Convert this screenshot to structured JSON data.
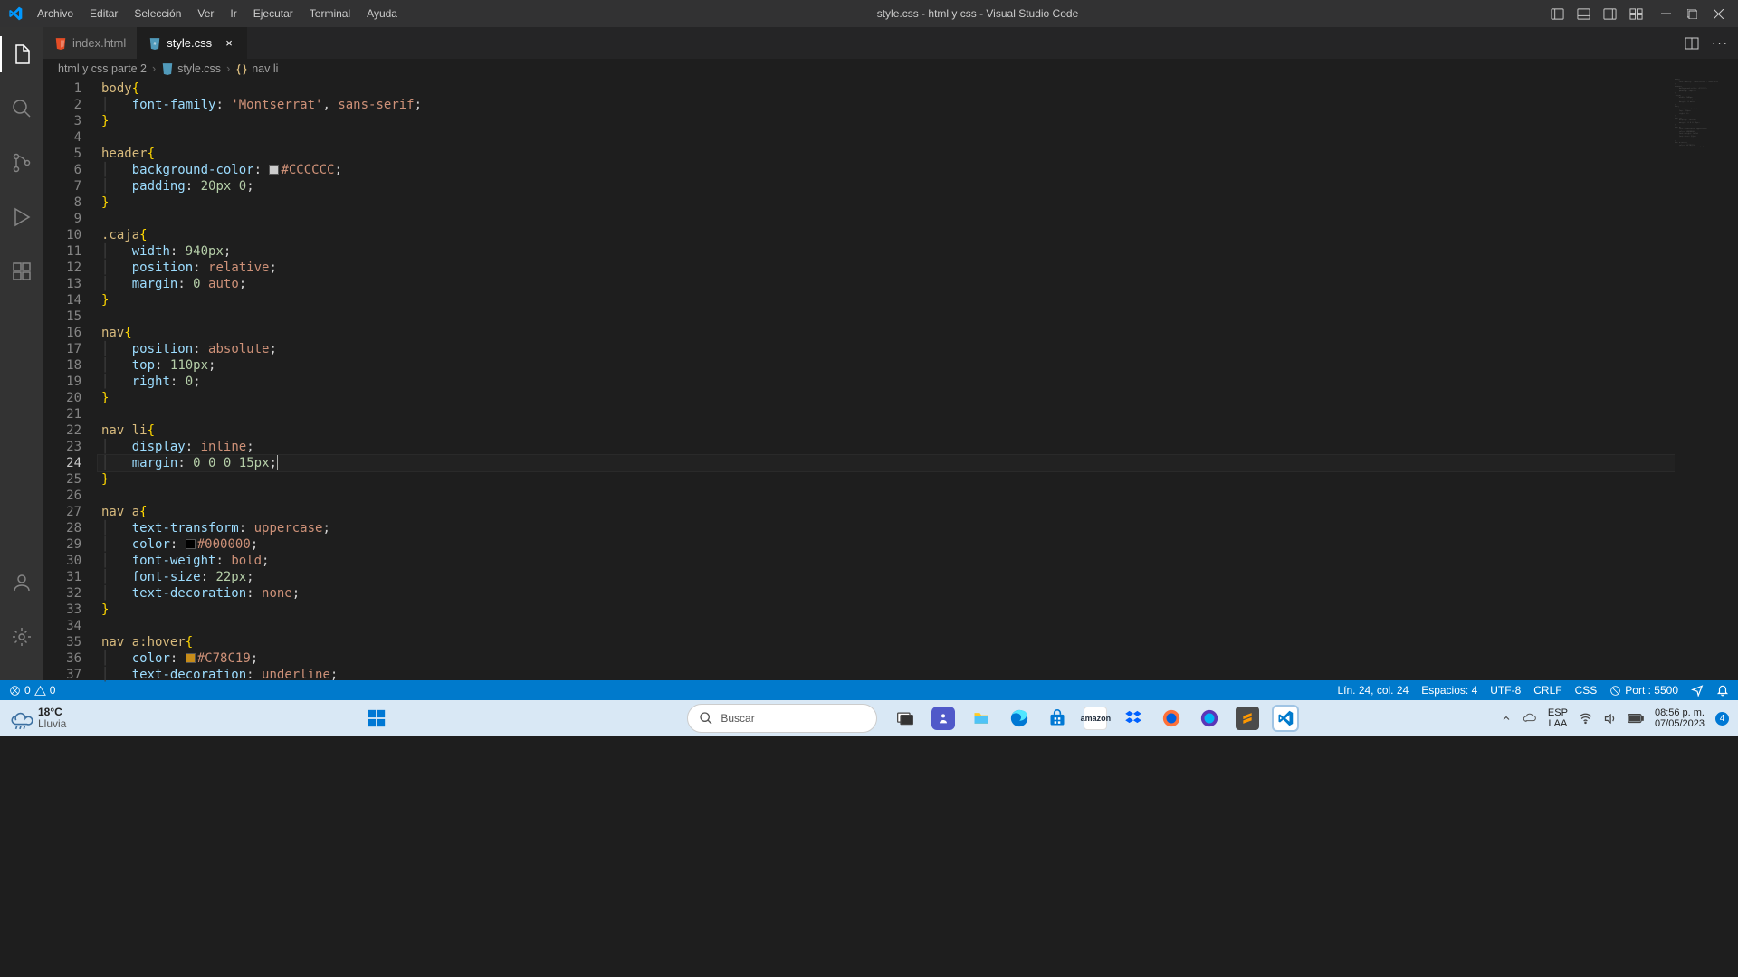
{
  "titlebar": {
    "menus": [
      "Archivo",
      "Editar",
      "Selección",
      "Ver",
      "Ir",
      "Ejecutar",
      "Terminal",
      "Ayuda"
    ],
    "title": "style.css - html y css - Visual Studio Code"
  },
  "tabs": [
    {
      "name": "index.html",
      "icon": "html",
      "icon_color": "#e44d26",
      "active": false
    },
    {
      "name": "style.css",
      "icon": "css",
      "icon_color": "#519aba",
      "active": true,
      "close": true
    }
  ],
  "breadcrumbs": {
    "parts": [
      "html y css parte 2",
      "style.css",
      "nav li"
    ]
  },
  "code": {
    "current_line": 24,
    "lines": [
      [
        {
          "t": "body",
          "c": "sel"
        },
        {
          "t": "{",
          "c": "brace"
        }
      ],
      [
        {
          "t": "    ",
          "c": ""
        },
        {
          "t": "font-family",
          "c": "prop"
        },
        {
          "t": ": ",
          "c": "punct"
        },
        {
          "t": "'Montserrat'",
          "c": "val"
        },
        {
          "t": ", ",
          "c": "punct"
        },
        {
          "t": "sans-serif",
          "c": "kw"
        },
        {
          "t": ";",
          "c": "punct"
        }
      ],
      [
        {
          "t": "}",
          "c": "brace"
        }
      ],
      [],
      [
        {
          "t": "header",
          "c": "sel"
        },
        {
          "t": "{",
          "c": "brace"
        }
      ],
      [
        {
          "t": "    ",
          "c": ""
        },
        {
          "t": "background-color",
          "c": "prop"
        },
        {
          "t": ": ",
          "c": "punct"
        },
        {
          "t": "□",
          "c": "colorswatch",
          "bg": "#CCCCCC"
        },
        {
          "t": "#CCCCCC",
          "c": "kw"
        },
        {
          "t": ";",
          "c": "punct"
        }
      ],
      [
        {
          "t": "    ",
          "c": ""
        },
        {
          "t": "padding",
          "c": "prop"
        },
        {
          "t": ": ",
          "c": "punct"
        },
        {
          "t": "20px",
          "c": "num"
        },
        {
          "t": " ",
          "c": ""
        },
        {
          "t": "0",
          "c": "num"
        },
        {
          "t": ";",
          "c": "punct"
        }
      ],
      [
        {
          "t": "}",
          "c": "brace"
        }
      ],
      [],
      [
        {
          "t": ".caja",
          "c": "sel"
        },
        {
          "t": "{",
          "c": "brace"
        }
      ],
      [
        {
          "t": "    ",
          "c": ""
        },
        {
          "t": "width",
          "c": "prop"
        },
        {
          "t": ": ",
          "c": "punct"
        },
        {
          "t": "940px",
          "c": "num"
        },
        {
          "t": ";",
          "c": "punct"
        }
      ],
      [
        {
          "t": "    ",
          "c": ""
        },
        {
          "t": "position",
          "c": "prop"
        },
        {
          "t": ": ",
          "c": "punct"
        },
        {
          "t": "relative",
          "c": "kw"
        },
        {
          "t": ";",
          "c": "punct"
        }
      ],
      [
        {
          "t": "    ",
          "c": ""
        },
        {
          "t": "margin",
          "c": "prop"
        },
        {
          "t": ": ",
          "c": "punct"
        },
        {
          "t": "0",
          "c": "num"
        },
        {
          "t": " ",
          "c": ""
        },
        {
          "t": "auto",
          "c": "kw"
        },
        {
          "t": ";",
          "c": "punct"
        }
      ],
      [
        {
          "t": "}",
          "c": "brace"
        }
      ],
      [],
      [
        {
          "t": "nav",
          "c": "sel"
        },
        {
          "t": "{",
          "c": "brace"
        }
      ],
      [
        {
          "t": "    ",
          "c": ""
        },
        {
          "t": "position",
          "c": "prop"
        },
        {
          "t": ": ",
          "c": "punct"
        },
        {
          "t": "absolute",
          "c": "kw"
        },
        {
          "t": ";",
          "c": "punct"
        }
      ],
      [
        {
          "t": "    ",
          "c": ""
        },
        {
          "t": "top",
          "c": "prop"
        },
        {
          "t": ": ",
          "c": "punct"
        },
        {
          "t": "110px",
          "c": "num"
        },
        {
          "t": ";",
          "c": "punct"
        }
      ],
      [
        {
          "t": "    ",
          "c": ""
        },
        {
          "t": "right",
          "c": "prop"
        },
        {
          "t": ": ",
          "c": "punct"
        },
        {
          "t": "0",
          "c": "num"
        },
        {
          "t": ";",
          "c": "punct"
        }
      ],
      [
        {
          "t": "}",
          "c": "brace"
        }
      ],
      [],
      [
        {
          "t": "nav li",
          "c": "sel"
        },
        {
          "t": "{",
          "c": "brace"
        }
      ],
      [
        {
          "t": "    ",
          "c": ""
        },
        {
          "t": "display",
          "c": "prop"
        },
        {
          "t": ": ",
          "c": "punct"
        },
        {
          "t": "inline",
          "c": "kw"
        },
        {
          "t": ";",
          "c": "punct"
        }
      ],
      [
        {
          "t": "    ",
          "c": ""
        },
        {
          "t": "margin",
          "c": "prop"
        },
        {
          "t": ": ",
          "c": "punct"
        },
        {
          "t": "0",
          "c": "num"
        },
        {
          "t": " ",
          "c": ""
        },
        {
          "t": "0",
          "c": "num"
        },
        {
          "t": " ",
          "c": ""
        },
        {
          "t": "0",
          "c": "num"
        },
        {
          "t": " ",
          "c": ""
        },
        {
          "t": "15px",
          "c": "num"
        },
        {
          "t": ";",
          "c": "punct"
        },
        {
          "t": "",
          "c": "cursor"
        }
      ],
      [
        {
          "t": "}",
          "c": "brace"
        }
      ],
      [],
      [
        {
          "t": "nav a",
          "c": "sel"
        },
        {
          "t": "{",
          "c": "brace"
        }
      ],
      [
        {
          "t": "    ",
          "c": ""
        },
        {
          "t": "text-transform",
          "c": "prop"
        },
        {
          "t": ": ",
          "c": "punct"
        },
        {
          "t": "uppercase",
          "c": "kw"
        },
        {
          "t": ";",
          "c": "punct"
        }
      ],
      [
        {
          "t": "    ",
          "c": ""
        },
        {
          "t": "color",
          "c": "prop"
        },
        {
          "t": ": ",
          "c": "punct"
        },
        {
          "t": "□",
          "c": "colorswatch",
          "bg": "#000000"
        },
        {
          "t": "#000000",
          "c": "kw"
        },
        {
          "t": ";",
          "c": "punct"
        }
      ],
      [
        {
          "t": "    ",
          "c": ""
        },
        {
          "t": "font-weight",
          "c": "prop"
        },
        {
          "t": ": ",
          "c": "punct"
        },
        {
          "t": "bold",
          "c": "kw"
        },
        {
          "t": ";",
          "c": "punct"
        }
      ],
      [
        {
          "t": "    ",
          "c": ""
        },
        {
          "t": "font-size",
          "c": "prop"
        },
        {
          "t": ": ",
          "c": "punct"
        },
        {
          "t": "22px",
          "c": "num"
        },
        {
          "t": ";",
          "c": "punct"
        }
      ],
      [
        {
          "t": "    ",
          "c": ""
        },
        {
          "t": "text-decoration",
          "c": "prop"
        },
        {
          "t": ": ",
          "c": "punct"
        },
        {
          "t": "none",
          "c": "kw"
        },
        {
          "t": ";",
          "c": "punct"
        }
      ],
      [
        {
          "t": "}",
          "c": "brace"
        }
      ],
      [],
      [
        {
          "t": "nav a:hover",
          "c": "sel"
        },
        {
          "t": "{",
          "c": "brace"
        }
      ],
      [
        {
          "t": "    ",
          "c": ""
        },
        {
          "t": "color",
          "c": "prop"
        },
        {
          "t": ": ",
          "c": "punct"
        },
        {
          "t": "□",
          "c": "colorswatch",
          "bg": "#C78C19"
        },
        {
          "t": "#C78C19",
          "c": "kw"
        },
        {
          "t": ";",
          "c": "punct"
        }
      ],
      [
        {
          "t": "    ",
          "c": ""
        },
        {
          "t": "text-decoration",
          "c": "prop"
        },
        {
          "t": ": ",
          "c": "punct"
        },
        {
          "t": "underline",
          "c": "kw"
        },
        {
          "t": ";",
          "c": "punct"
        }
      ]
    ]
  },
  "statusbar": {
    "errors": "0",
    "warnings": "0",
    "lncol": "Lín. 24, col. 24",
    "spaces": "Espacios: 4",
    "encoding": "UTF-8",
    "eol": "CRLF",
    "lang": "CSS",
    "port": "Port : 5500"
  },
  "taskbar": {
    "temp": "18°C",
    "weather": "Lluvia",
    "search_placeholder": "Buscar",
    "lang1": "ESP",
    "lang2": "LAA",
    "time": "08:56 p. m.",
    "date": "07/05/2023",
    "notif_count": "4"
  }
}
